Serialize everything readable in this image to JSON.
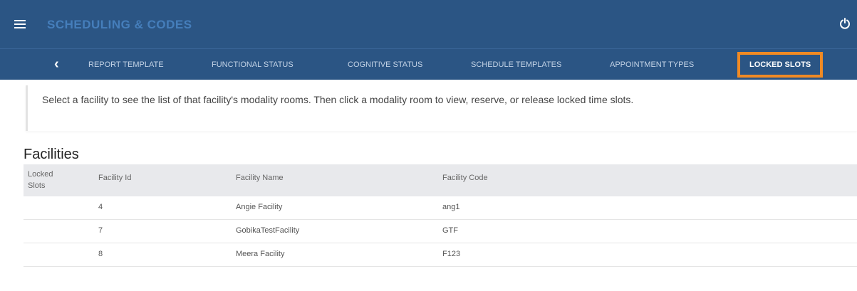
{
  "header": {
    "title": "SCHEDULING & CODES",
    "menu_icon": "hamburger-icon",
    "power_icon": "power-icon",
    "bg_color": "#2b5584"
  },
  "tabs": {
    "prev_icon": "chevron-left-icon",
    "prev_label": "‹",
    "items": [
      {
        "label": "REPORT TEMPLATE"
      },
      {
        "label": "FUNCTIONAL STATUS"
      },
      {
        "label": "COGNITIVE STATUS"
      },
      {
        "label": "SCHEDULE TEMPLATES"
      },
      {
        "label": "APPOINTMENT TYPES"
      },
      {
        "label": "LOCKED SLOTS",
        "active": true
      }
    ],
    "highlight_color": "#f08a24"
  },
  "info": {
    "text": "Select a facility to see the list of that facility's modality rooms. Then click a modality room to view, reserve, or release locked time slots."
  },
  "facilities": {
    "title": "Facilities",
    "columns": {
      "locked": "Locked Slots",
      "id": "Facility Id",
      "name": "Facility Name",
      "code": "Facility Code"
    },
    "rows": [
      {
        "id": "4",
        "name": "Angie Facility",
        "code": "ang1"
      },
      {
        "id": "7",
        "name": "GobikaTestFacility",
        "code": "GTF"
      },
      {
        "id": "8",
        "name": "Meera Facility",
        "code": "F123"
      }
    ]
  }
}
